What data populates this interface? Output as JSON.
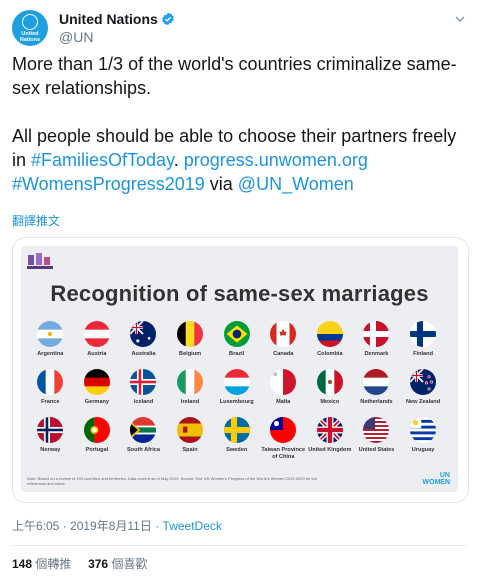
{
  "tweet": {
    "author_name": "United Nations",
    "author_handle": "@UN",
    "avatar_text": "United\nNations",
    "text_line1": "More than 1/3 of the world's countries criminalize same-sex relationships.",
    "text_line2_prefix": "All people should be able to choose their partners freely in ",
    "hashtag1": "#FamiliesOfToday",
    "text_dot": ". ",
    "link_url": "progress.unwomen.org",
    "hashtag2": "#WomensProgress2019",
    "text_via": " via ",
    "mention": "@UN_Women",
    "translate_label": "翻譯推文",
    "timestamp": "上午6:05 · 2019年8月11日",
    "dot_sep": " · ",
    "source": "TweetDeck",
    "retweets_count": "148",
    "retweets_label": "個轉推",
    "likes_count": "376",
    "likes_label": "個喜歡"
  },
  "card": {
    "title": "Recognition of same-sex marriages",
    "note": "Note: Based on a review of 193 countries and territories. Data current as of May 2019. Source: See UN Women's Progress of the World's Women 2019-2020 for full references and notes.",
    "logo_text": "UN\nWOMEN",
    "rows": [
      [
        "Argentina",
        "Austria",
        "Australia",
        "Belgium",
        "Brazil",
        "Canada",
        "Colombia",
        "Denmark",
        "Finland"
      ],
      [
        "France",
        "Germany",
        "Iceland",
        "Ireland",
        "Luxembourg",
        "Malta",
        "Mexico",
        "Netherlands",
        "New Zealand"
      ],
      [
        "Norway",
        "Portugal",
        "South Africa",
        "Spain",
        "Sweden",
        "Taiwan Province of China",
        "United Kingdom",
        "United States",
        "Uruguay"
      ]
    ]
  },
  "colors": {
    "link": "#1b95e0",
    "avatar_bg": "#1e9fe0",
    "muted": "#657786"
  }
}
